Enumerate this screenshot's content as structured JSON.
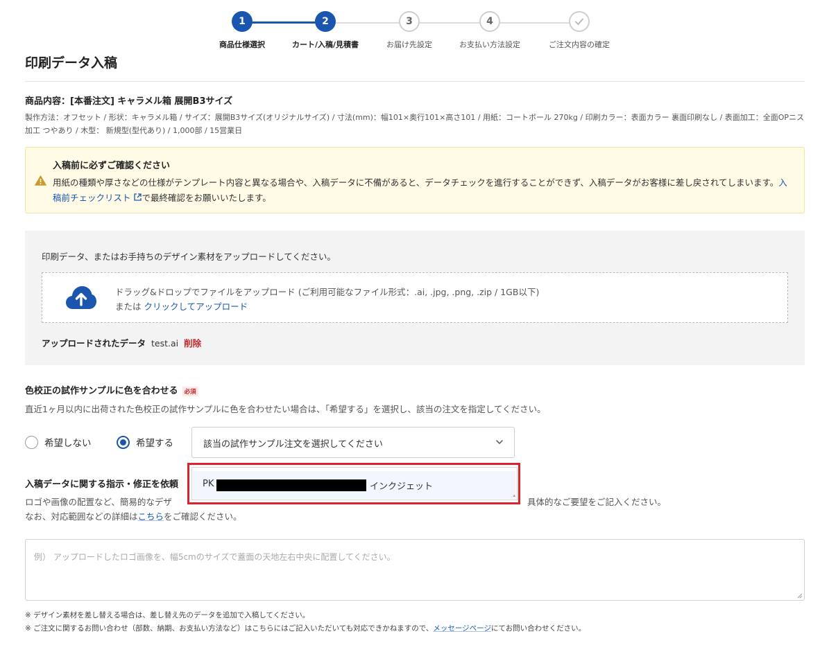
{
  "stepper": {
    "steps": [
      {
        "number": "1",
        "label": "商品仕様選択",
        "state": "done"
      },
      {
        "number": "2",
        "label": "カート/入稿/見積書",
        "state": "current"
      },
      {
        "number": "3",
        "label": "お届け先設定",
        "state": "pending"
      },
      {
        "number": "4",
        "label": "お支払い方法設定",
        "state": "pending"
      },
      {
        "number": "",
        "label": "ご注文内容の確定",
        "state": "pending",
        "icon": "check-icon"
      }
    ]
  },
  "page": {
    "title": "印刷データ入稿"
  },
  "product": {
    "title": "商品内容：[本番注文] キャラメル箱 展開B3サイズ",
    "description": "製作方法：オフセット / 形状：キャラメル箱 / サイズ：展開B3サイズ(オリジナルサイズ) / 寸法(mm)：幅101×奥行101×高さ101 / 用紙：コートボール 270kg / 印刷カラー：表面カラー 裏面印刷なし / 表面加工：全面OPニス加工 つやあり / 木型： 新規型(型代あり) / 1,000部 / 15営業日"
  },
  "notice": {
    "icon": "warning-icon",
    "title": "入稿前に必ずご確認ください",
    "body_before": "用紙の種類や厚さなどの仕様がテンプレート内容と異なる場合や、入稿データに不備があると、データチェックを進行することができず、入稿データがお客様に差し戻されてしまいます。",
    "link_label": "入稿前チェックリスト",
    "body_after": "で最終確認をお願いいたします。"
  },
  "upload": {
    "intro": "印刷データ、またはお手持ちのデザイン素材をアップロードしてください。",
    "drop_text": "ドラッグ&ドロップでファイルをアップロード (ご利用可能なファイル形式：.ai, .jpg, .png, .zip / 1GB以下)",
    "or_text": "または",
    "click_label": "クリックしてアップロード",
    "uploaded_label": "アップロードされたデータ",
    "uploaded_file": "test.ai",
    "delete_label": "削除"
  },
  "color_sample": {
    "title": "色校正の試作サンプルに色を合わせる",
    "required_badge": "必須",
    "description": "直近1ヶ月以内に出荷された色校正の試作サンプルに色を合わせたい場合は、「希望する」を選択し、該当の注文を指定してください。",
    "option_no": "希望しない",
    "option_yes": "希望する",
    "selected": "yes",
    "select_placeholder": "該当の試作サンプル注文を選択してください",
    "dropdown_option_prefix": "PK",
    "dropdown_option_suffix": "インクジェット"
  },
  "instructions": {
    "title": "入稿データに関する指示・修正を依頼",
    "desc_line1_start": "ロゴや画像の配置など、簡易的なデザ",
    "desc_line1_end": "具体的なご要望をご記入ください。",
    "desc_line2_before": "なお、対応範囲などの詳細は",
    "desc_line2_link": "こちら",
    "desc_line2_after": "をご確認ください。",
    "placeholder": "例） アップロードしたロゴ画像を、幅5cmのサイズで蓋面の天地左右中央に配置してください。"
  },
  "footnotes": {
    "note1": "※ デザイン素材を差し替える場合は、差し替え先のデータを追加で入稿してください。",
    "note2_before": "※ ご注文に関するお問い合わせ（部数、納期、お支払い方法など）はこちらにはご記入いただいても対応できかねますので、",
    "note2_link": "メッセージページ",
    "note2_after": "にてお問い合わせください。"
  },
  "colors": {
    "accent": "#1a56b0",
    "danger": "#c0282d",
    "highlight_box": "#d9232d",
    "notice_bg": "#fffbe6"
  }
}
